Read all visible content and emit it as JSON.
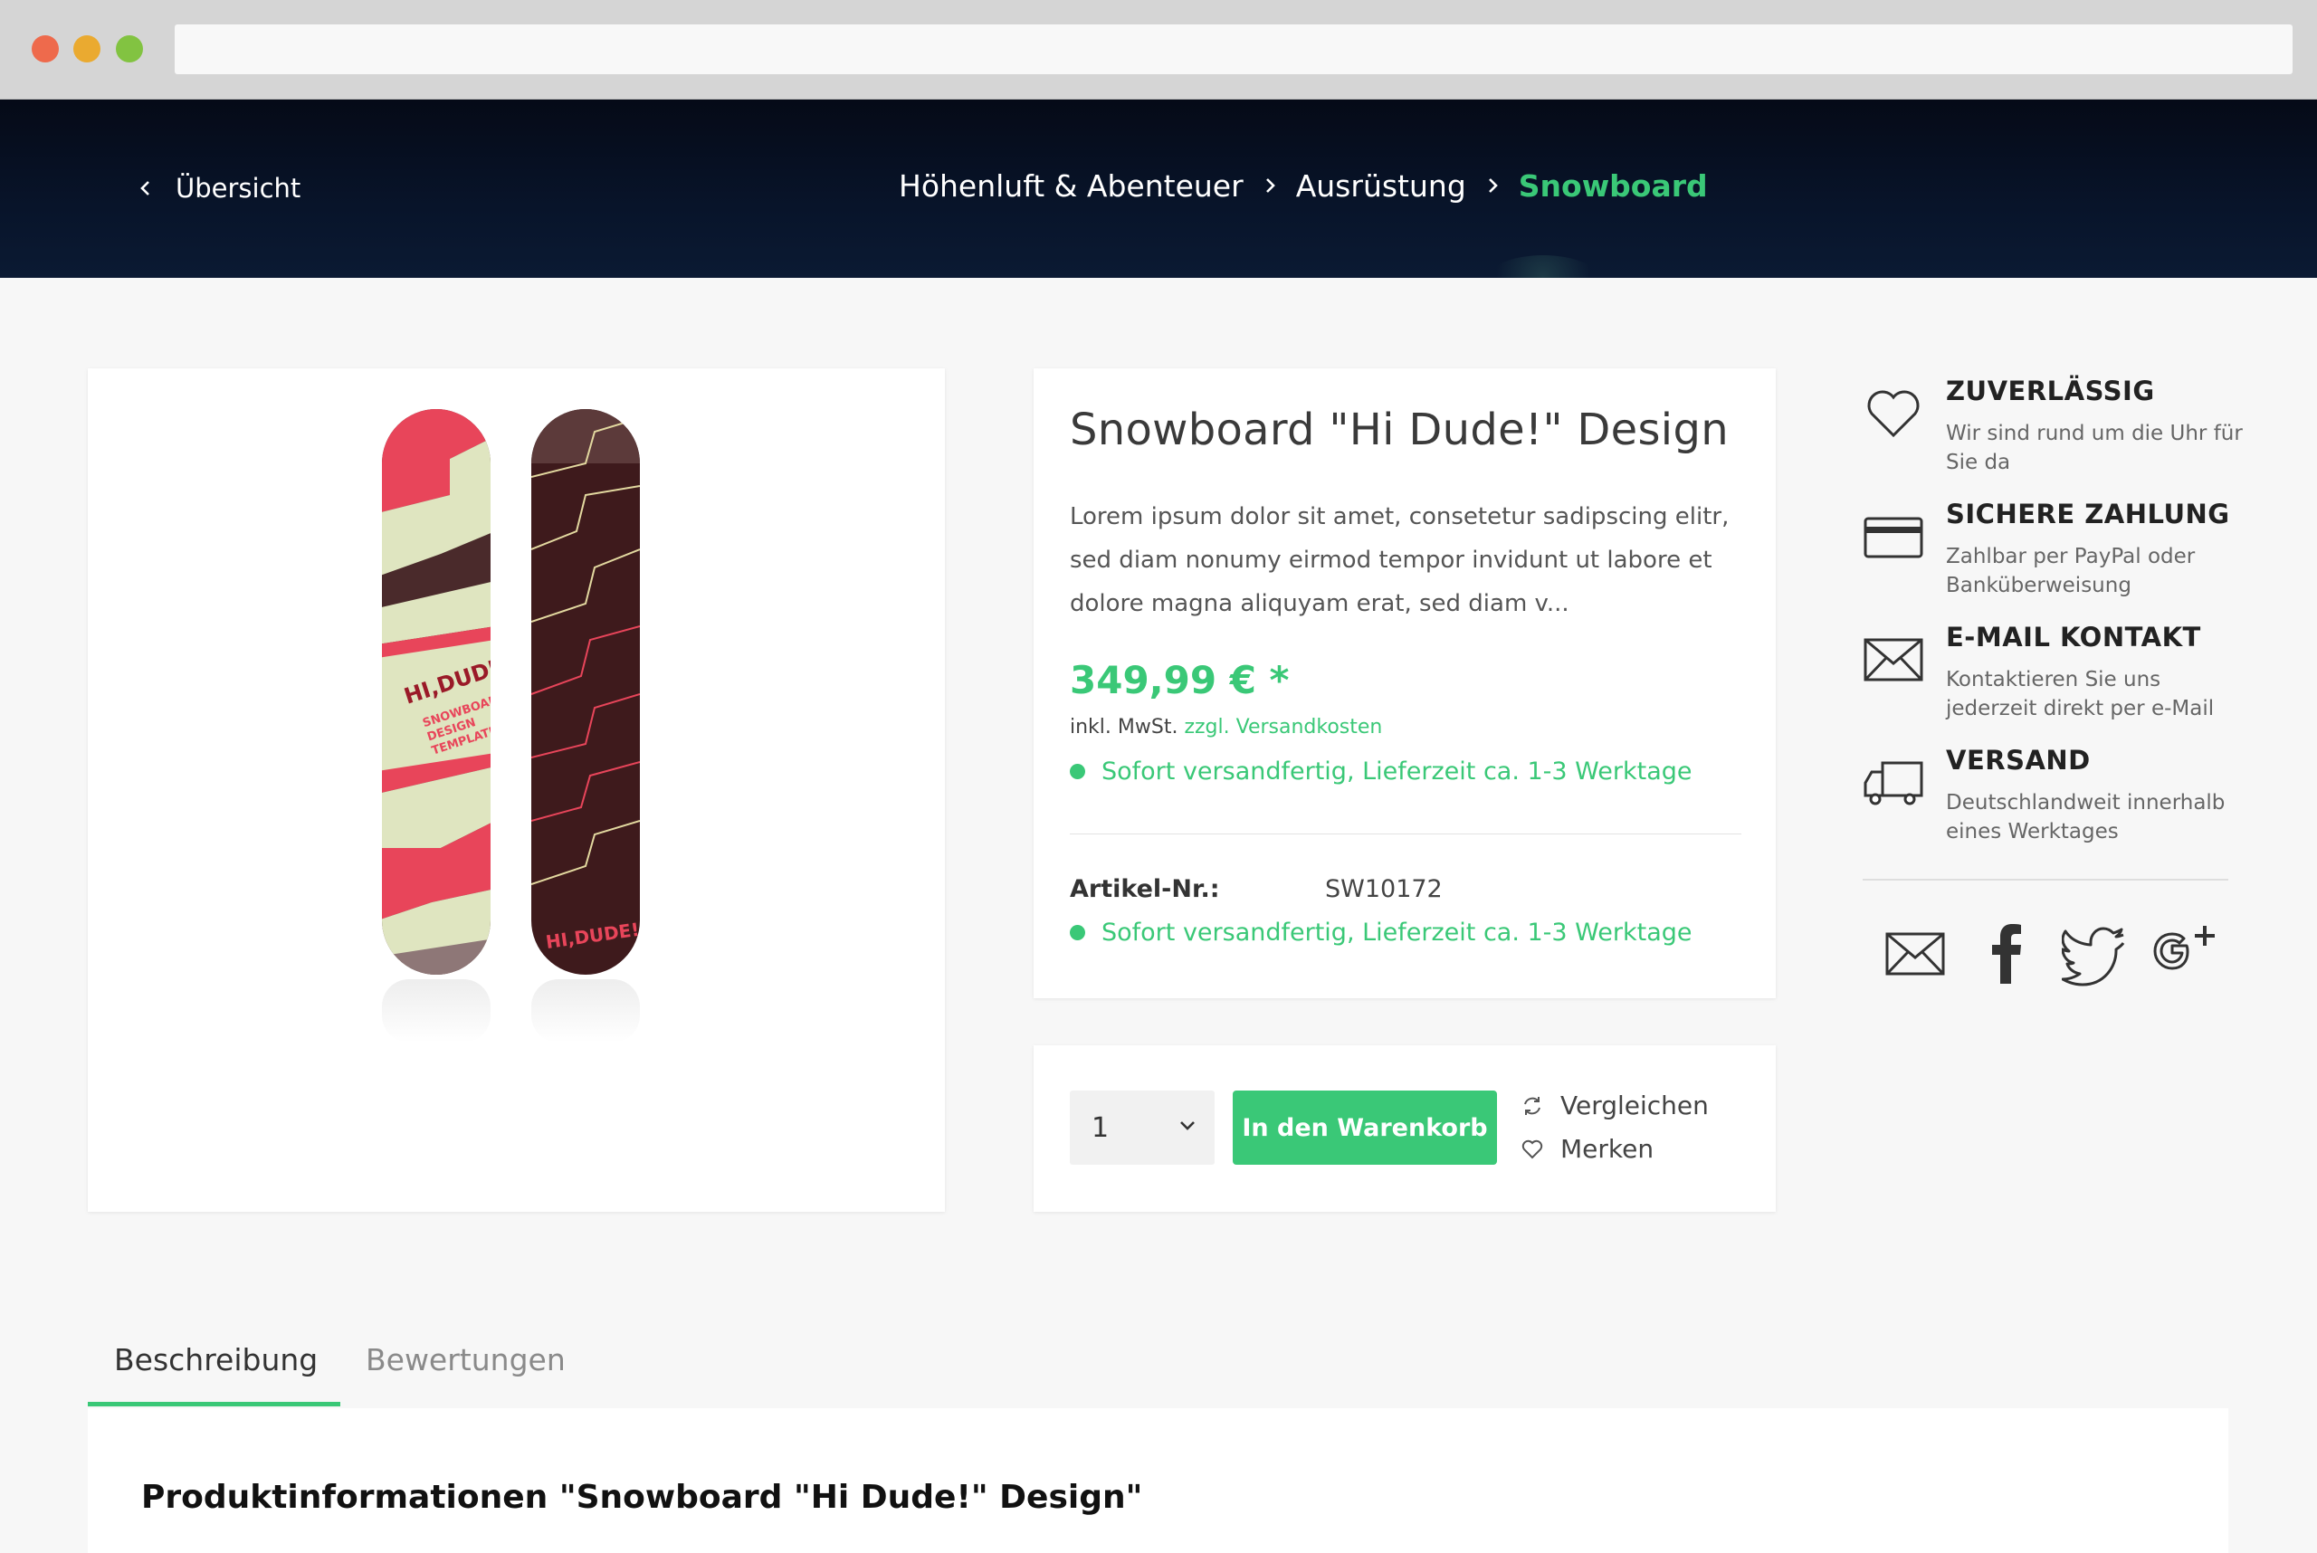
{
  "header": {
    "back_label": "Übersicht",
    "breadcrumb": [
      "Höhenluft & Abenteuer",
      "Ausrüstung",
      "Snowboard"
    ]
  },
  "product": {
    "title": "Snowboard \"Hi Dude!\" Design",
    "description": "Lorem ipsum dolor sit amet, consetetur sadipscing elitr, sed diam nonumy eirmod tempor invidunt ut labore et dolore magna aliquyam erat, sed diam v...",
    "price": "349,99 € *",
    "tax_prefix": "inkl. MwSt.",
    "shipping_link": "zzgl. Versandkosten",
    "availability": "Sofort versandfertig, Lieferzeit ca. 1-3 Werktage",
    "article_label": "Artikel-Nr.:",
    "article_number": "SW10172",
    "board_text": "HI,DUDE!",
    "board_subtext": [
      "SNOWBOARD",
      "DESIGN",
      "TEMPLATE"
    ]
  },
  "buy": {
    "quantity": "1",
    "add_to_cart": "In den Warenkorb",
    "compare": "Vergleichen",
    "remember": "Merken"
  },
  "usps": [
    {
      "title": "ZUVERLÄSSIG",
      "text": "Wir sind rund um die Uhr für Sie da",
      "icon": "heart-icon"
    },
    {
      "title": "SICHERE ZAHLUNG",
      "text": "Zahlbar per PayPal oder Banküberweisung",
      "icon": "credit-card-icon"
    },
    {
      "title": "E-MAIL KONTAKT",
      "text": "Kontaktieren Sie uns jederzeit direkt per e-Mail",
      "icon": "mail-icon"
    },
    {
      "title": "VERSAND",
      "text": "Deutschlandweit innerhalb eines Werktages",
      "icon": "truck-icon"
    }
  ],
  "tabs": {
    "description": "Beschreibung",
    "reviews": "Bewertungen"
  },
  "content": {
    "heading": "Produktinformationen \"Snowboard \"Hi Dude!\" Design\""
  },
  "colors": {
    "accent": "#3ac877",
    "header_bg": "#08142a",
    "board_red": "#e8455a",
    "board_cream": "#dfe5c0",
    "board_dark": "#4a1e20"
  }
}
